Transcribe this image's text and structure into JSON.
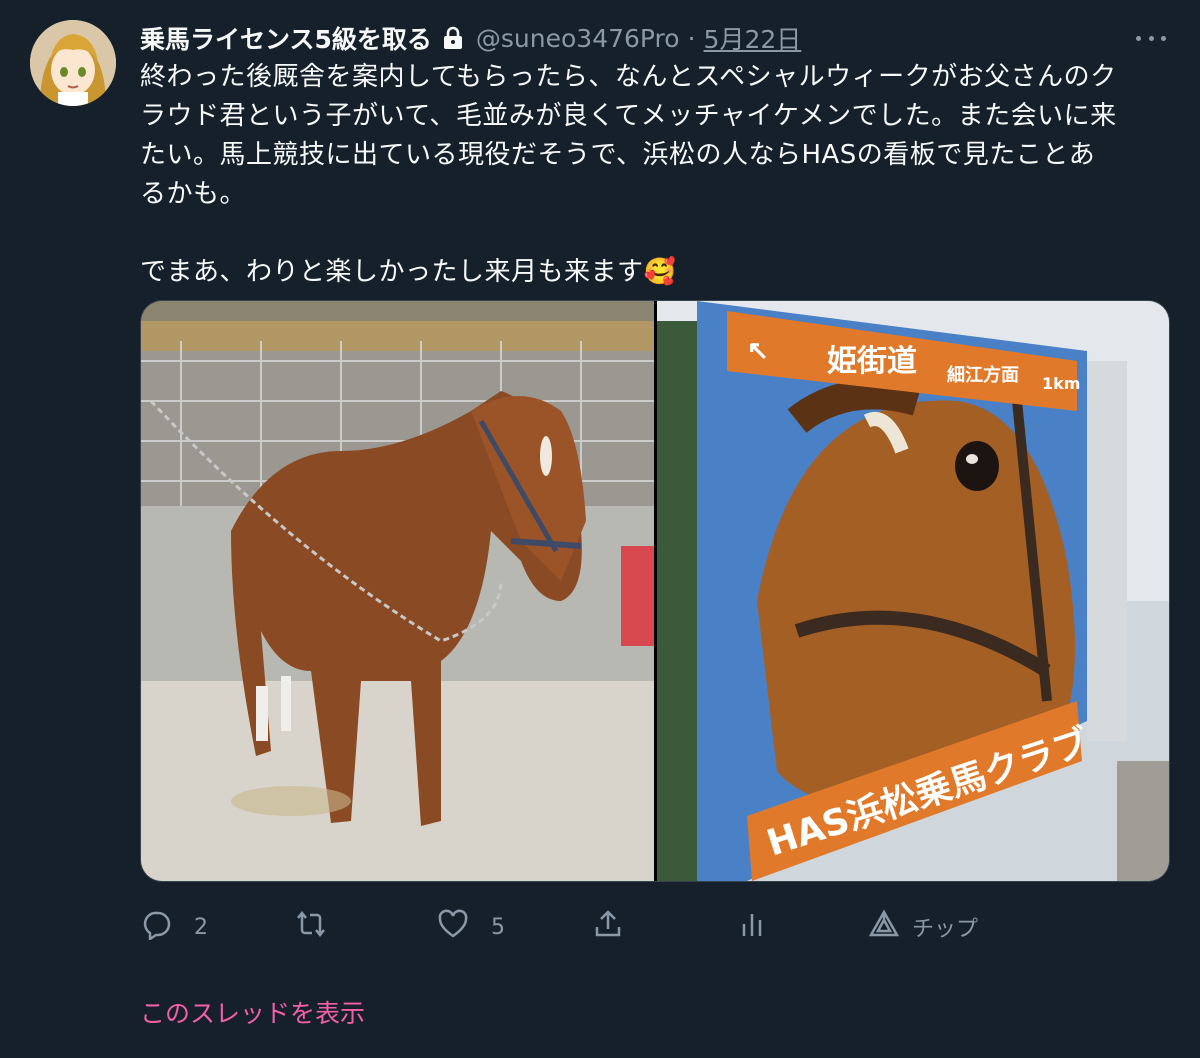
{
  "author": {
    "display_name": "乗馬ライセンス5級を取る",
    "handle": "@suneo3476Pro",
    "separator": "·",
    "date": "5月22日",
    "avatar": "anime-girl-avatar",
    "protected_icon": "lock-icon"
  },
  "tweet": {
    "line1": "終わった後厩舎を案内してもらったら、なんとスペシャルウィークがお父さんのク",
    "line2": "ラウド君という子がいて、毛並みが良くてメッチャイケメンでした。また会いに来",
    "line3": "たい。馬上競技に出ている現役だそうで、浜松の人ならHASの看板で見たことあ",
    "line4": "るかも。",
    "line5": "でまあ、わりと楽しかったし来月も来ます",
    "emoji": "🥰"
  },
  "media": {
    "photo1": "chestnut-horse-in-stable-photo",
    "photo2": "has-sign-photo",
    "sign_road": "姫街道",
    "sign_direction": "細江方面",
    "sign_distance": "1km",
    "sign_club": "HAS浜松乗馬クラブ"
  },
  "actions": {
    "reply_count": "2",
    "retweet_count": "",
    "like_count": "5",
    "tip_label": "チップ"
  },
  "show_thread": "このスレッドを表示",
  "colors": {
    "background": "#15202b",
    "text": "#f7f9f9",
    "muted": "#8b98a5",
    "thread_link": "#f35fa7"
  }
}
